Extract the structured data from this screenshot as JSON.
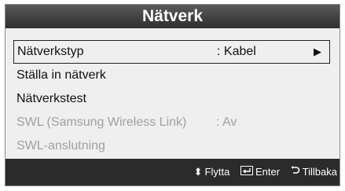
{
  "window": {
    "title": "Nätverk"
  },
  "menu": {
    "items": [
      {
        "label": "Nätverkstyp",
        "value": ": Kabel",
        "arrow": "▶",
        "selected": true,
        "enabled": true
      },
      {
        "label": "Ställa in nätverk",
        "value": "",
        "selected": false,
        "enabled": true
      },
      {
        "label": "Nätverkstest",
        "value": "",
        "selected": false,
        "enabled": true
      },
      {
        "label": "SWL (Samsung Wireless Link)",
        "value": ": Av",
        "selected": false,
        "enabled": false
      },
      {
        "label": "SWL-anslutning",
        "value": "",
        "selected": false,
        "enabled": false
      }
    ]
  },
  "footer": {
    "move": {
      "icon": "up-down-arrow-icon",
      "glyph": "⬍",
      "label": "Flytta"
    },
    "enter": {
      "icon": "enter-icon",
      "glyph": "↵",
      "label": "Enter"
    },
    "back": {
      "icon": "return-icon",
      "glyph": "↺",
      "label": "Tillbaka"
    }
  },
  "colors": {
    "title_bar": "#3a3a3a",
    "panel_bg": "#efefef",
    "footer_bg": "#2b2b2b",
    "disabled_text": "#a0a0a0"
  }
}
